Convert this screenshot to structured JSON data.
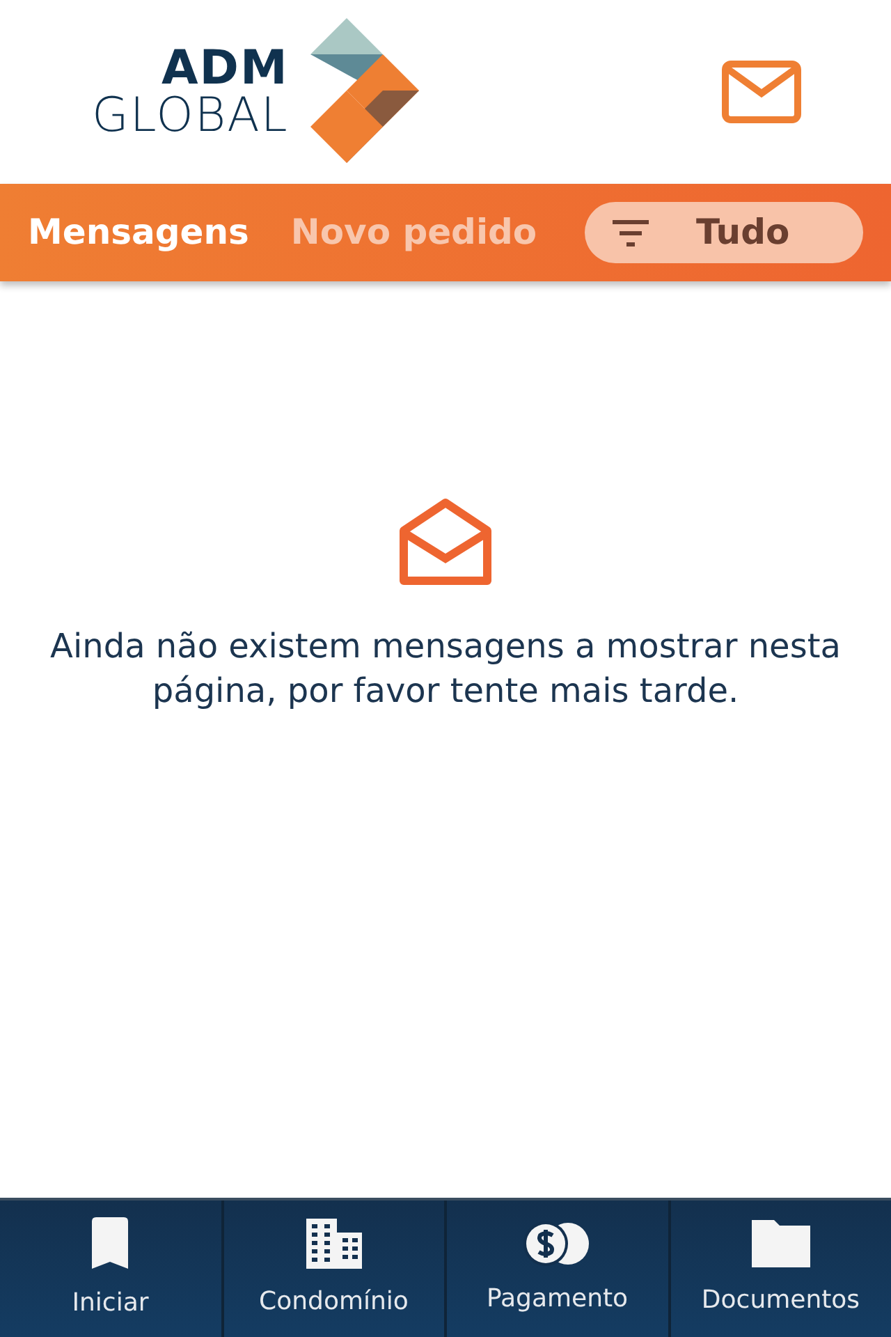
{
  "header": {
    "logo": {
      "line_1": "ADM",
      "line_2": "GLOBAL"
    }
  },
  "tabs": [
    {
      "label": "Mensagens",
      "selected": true
    },
    {
      "label": "Novo pedido",
      "selected": false
    }
  ],
  "filter": {
    "label": "Tudo"
  },
  "empty_state": {
    "message": "Ainda não existem mensagens a mostrar nesta página, por favor tente mais tarde."
  },
  "bottom_nav": [
    {
      "kind": "bookmark",
      "label": "Iniciar"
    },
    {
      "kind": "building",
      "label": "Condomínio"
    },
    {
      "kind": "coins",
      "label": "Pagamento"
    },
    {
      "kind": "folder",
      "label": "Documentos"
    }
  ]
}
